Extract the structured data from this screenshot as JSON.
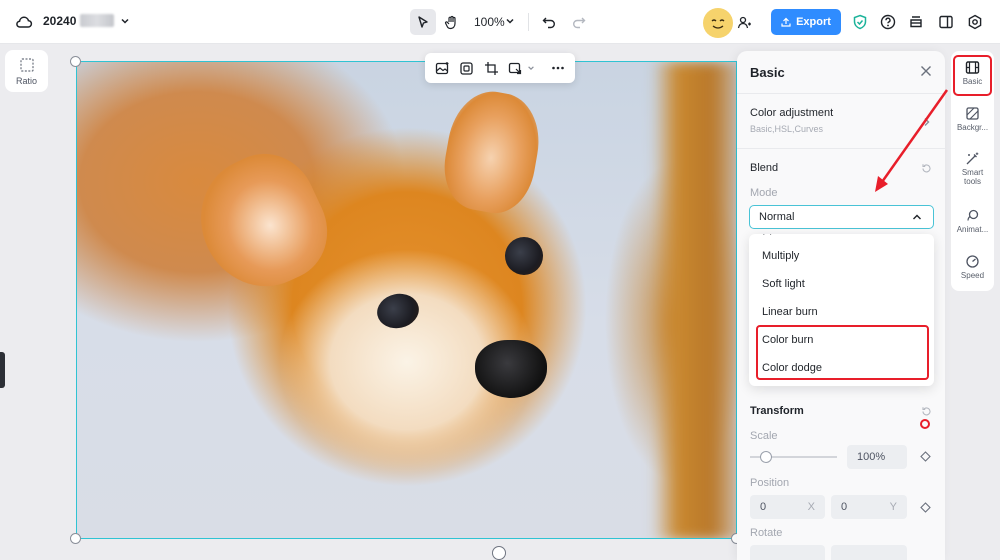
{
  "header": {
    "project_title": "20240",
    "zoom_label": "100%",
    "export_label": "Export"
  },
  "left": {
    "ratio_label": "Ratio"
  },
  "panel": {
    "title": "Basic",
    "color_adjustment": {
      "title": "Color adjustment",
      "subtitle": "Basic,HSL,Curves"
    },
    "blend": {
      "title": "Blend",
      "mode_label": "Mode",
      "selected_mode": "Normal",
      "options": [
        "Multiply",
        "Soft light",
        "Linear burn",
        "Color burn",
        "Color dodge"
      ],
      "highlighted_options": [
        "Color burn",
        "Color dodge"
      ]
    },
    "transform": {
      "title": "Transform",
      "scale_label": "Scale",
      "scale_value": "100%",
      "position_label": "Position",
      "position_x": "0",
      "position_x_unit": "X",
      "position_y": "0",
      "position_y_unit": "Y",
      "rotate_label": "Rotate"
    }
  },
  "sidebar": {
    "items": [
      {
        "label": "Basic",
        "icon": "film-icon"
      },
      {
        "label": "Backgr...",
        "icon": "background-icon"
      },
      {
        "label": "Smart tools",
        "icon": "magic-wand-icon"
      },
      {
        "label": "Animat...",
        "icon": "animation-icon"
      },
      {
        "label": "Speed",
        "icon": "speed-icon"
      }
    ]
  },
  "colors": {
    "accent": "#2f8cff",
    "selection": "#2fc3d3",
    "annotation": "#e81e2a"
  }
}
